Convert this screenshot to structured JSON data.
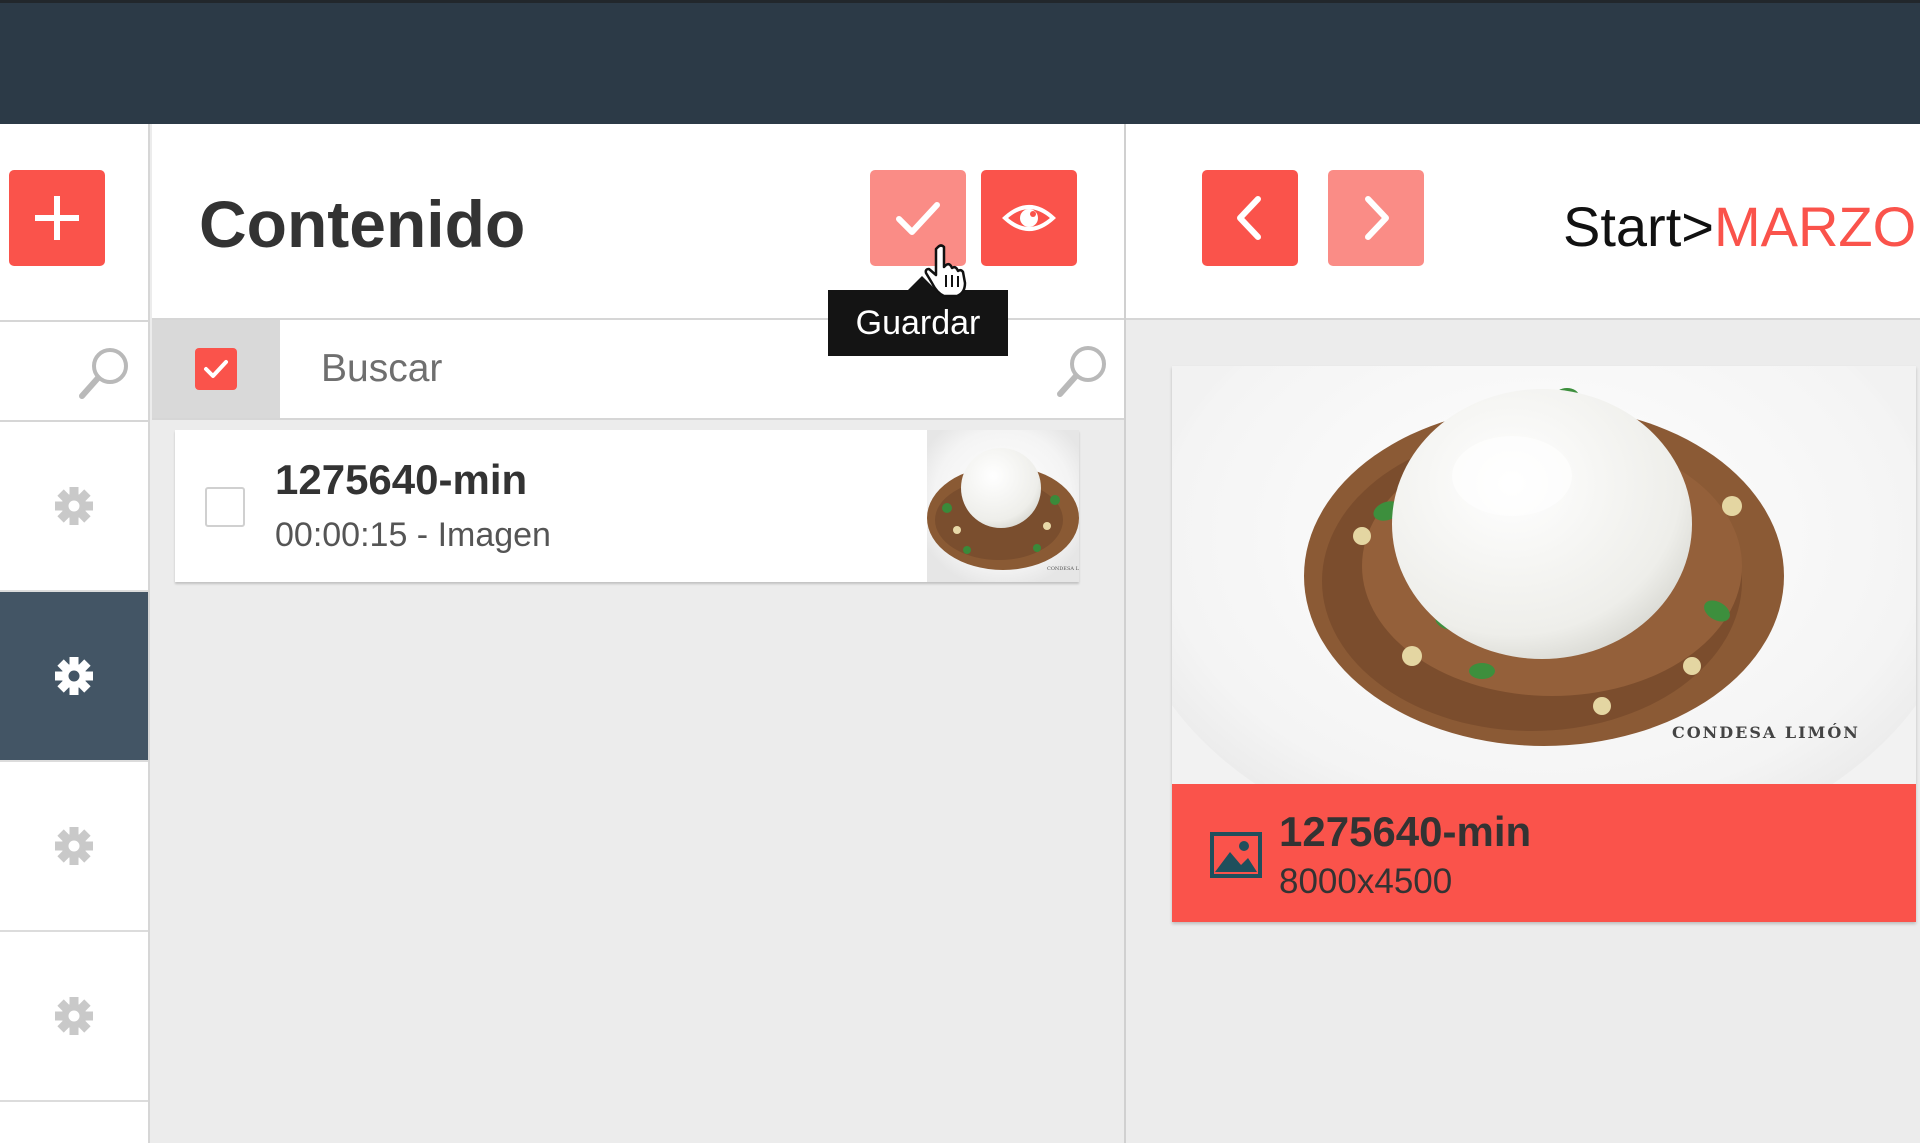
{
  "content_panel": {
    "title": "Contenido",
    "save_tooltip": "Guardar",
    "search_placeholder": "Buscar"
  },
  "list": {
    "items": [
      {
        "title": "1275640-min",
        "subtitle": "00:00:15 - Imagen",
        "thumbnail_caption": "CONDESA LIMÓN"
      }
    ]
  },
  "breadcrumb": {
    "root": "Start",
    "separator": ">",
    "current": "MARZO"
  },
  "preview": {
    "title": "1275640-min",
    "dimensions": "8000x4500",
    "image_caption": "CONDESA LIMÓN"
  },
  "icons": {
    "add": "plus-icon",
    "save": "check-icon",
    "view": "eye-icon",
    "prev": "chevron-left-icon",
    "next": "chevron-right-icon",
    "search": "search-icon",
    "gear": "gear-icon",
    "image": "image-icon"
  },
  "colors": {
    "accent": "#fa534b",
    "accent_light": "#fa8c86",
    "topbar": "#2c3a47",
    "sidebar_active": "#435565"
  }
}
